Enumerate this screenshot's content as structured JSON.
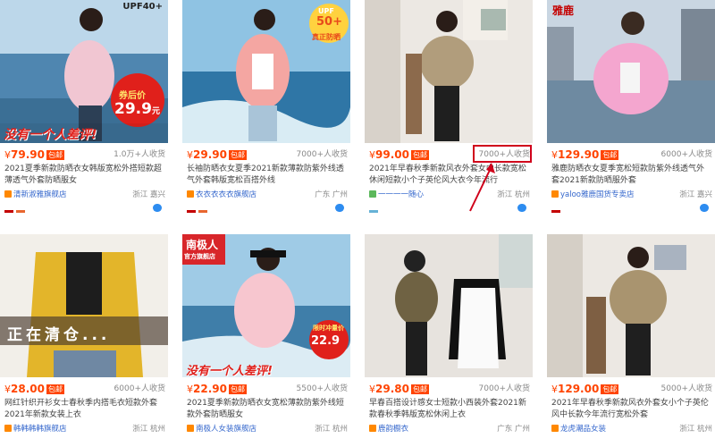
{
  "items": [
    {
      "price": "79.90",
      "tag": "包邮",
      "sales": "1.0万+人收货",
      "title": "2021夏季新款防晒衣女韩版宽松外搭短款超薄透气外套防晒服女",
      "shop": "清新淑雅旗舰店",
      "location": "浙江 嘉兴",
      "overlay": {
        "top_right": "UPF40+",
        "coupon_label": "券后价",
        "coupon_price": "29.9",
        "coupon_unit": "元",
        "banner": "没有一个人差评!"
      }
    },
    {
      "price": "29.90",
      "tag": "包邮",
      "sales": "7000+人收货",
      "title": "长袖防晒衣女夏季2021新款薄款防紫外线透气外套韩版宽松百搭外线",
      "shop": "衣衣衣衣衣旗舰店",
      "location": "广东 广州",
      "overlay": {
        "sun_badge_top": "UPF",
        "sun_badge_num": "50+",
        "sun_badge_bottom": "真正防晒"
      }
    },
    {
      "price": "99.00",
      "tag": "包邮",
      "sales": "7000+人收货",
      "title": "2021年早春秋季新款风衣外套女中长款宽松休闲短款小个子英伦风大衣今年流行",
      "shop": "一一一一随心",
      "location": "浙江 杭州",
      "overlay": {}
    },
    {
      "price": "129.90",
      "tag": "包邮",
      "sales": "6000+人收货",
      "title": "雅鹿防晒衣女夏季宽松短款防紫外线透气外套2021新款防晒服外套",
      "shop": "yaloo雅鹿国货专卖店",
      "location": "浙江 嘉兴",
      "overlay": {
        "brand": "雅鹿"
      }
    },
    {
      "price": "28.00",
      "tag": "包邮",
      "sales": "6000+人收货",
      "title": "网红针织开衫女士春秋季内搭毛衣短款外套2021年新款女装上衣",
      "shop": "韩韩韩韩旗舰店",
      "location": "浙江 杭州",
      "overlay": {
        "banner": "正在清仓..."
      }
    },
    {
      "price": "22.90",
      "tag": "包邮",
      "sales": "5500+人收货",
      "title": "2021夏季新款防晒衣女宽松薄款防紫外线短款外套防晒服女",
      "shop": "南极人女装旗舰店",
      "location": "浙江 杭州",
      "overlay": {
        "brand": "南极人",
        "brand_sub": "官方旗舰店",
        "coupon_label": "限时冲量价",
        "coupon_price": "22.9",
        "banner": "没有一个人差评!"
      }
    },
    {
      "price": "29.80",
      "tag": "包邮",
      "sales": "7000+人收货",
      "title": "早春百搭设计感女士短款小西装外套2021新款春秋季韩版宽松休闲上衣",
      "shop": "鹿韵橱衣",
      "location": "广东 广州",
      "overlay": {}
    },
    {
      "price": "129.00",
      "tag": "包邮",
      "sales": "5000+人收货",
      "title": "2021年早春秋季新款风衣外套女小个子英伦风中长款今年流行宽松外套",
      "shop": "龙虎潮品女装",
      "location": "浙江 杭州",
      "overlay": {}
    }
  ],
  "colors": {
    "price": "#ff4400",
    "highlight": "#d0021b",
    "shop_link": "#3366cc"
  }
}
